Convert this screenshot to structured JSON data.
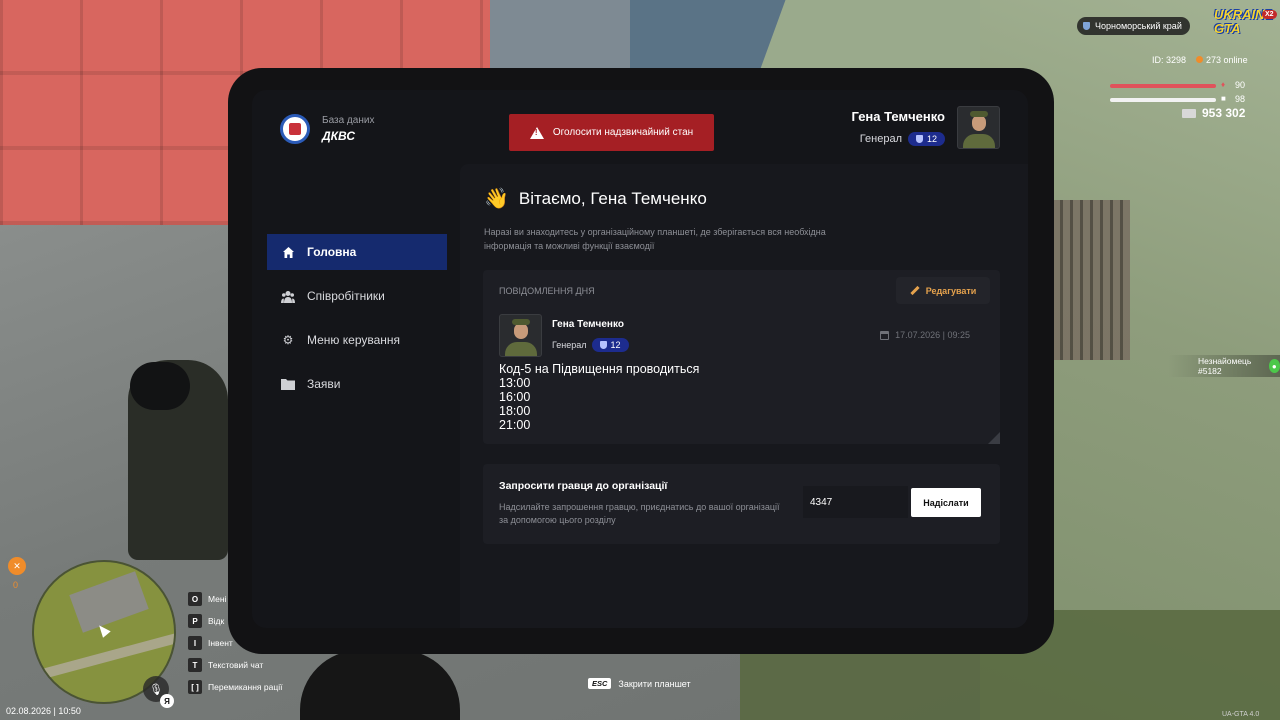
{
  "org": {
    "subtitle": "База даних",
    "name": "ДКВС"
  },
  "emergency_button": {
    "label": "Оголосити надзвичайний стан"
  },
  "profile": {
    "name": "Гена Темченко",
    "rank": "Генерал",
    "level": "12"
  },
  "sidebar": {
    "items": [
      {
        "label": "Головна",
        "icon": "home-icon",
        "active": true
      },
      {
        "label": "Співробітники",
        "icon": "people-icon",
        "active": false
      },
      {
        "label": "Меню керування",
        "icon": "gear-icon",
        "active": false
      },
      {
        "label": "Заяви",
        "icon": "folder-icon",
        "active": false
      }
    ]
  },
  "main": {
    "greeting": "Вітаємо, Гена Темченко",
    "greeting_emoji": "👋",
    "description": "Наразі ви знаходитесь у організаційному планшеті, де зберігається вся необхідна інформація та можливі функції взаємодії",
    "motd": {
      "title": "Повідомлення дня",
      "edit_label": "Редагувати",
      "author": "Гена Темченко",
      "author_rank": "Генерал",
      "author_level": "12",
      "date": "17.07.2026 | 09:25",
      "lines": [
        "Код-5 на Підвищення проводиться",
        "13:00",
        "16:00",
        "18:00",
        "21:00"
      ]
    },
    "invite": {
      "title": "Запросити гравця до організації",
      "description": "Надсилайте запрошення гравцю, приєднатись до вашої організації за допомогою цього розділу",
      "input_value": "4347",
      "send_label": "Надіслати"
    }
  },
  "hud": {
    "region": "Чорноморський край",
    "logo_line1": "UKRAINE",
    "logo_line2": "GTA",
    "logo_badge": "X2",
    "id_text": "ID: 3298",
    "online_text": "273 online",
    "health": "90",
    "armor": "98",
    "money": "953 302",
    "stranger": "Незнайомець #5182",
    "hunger_value": "0",
    "datetime": "02.08.2026 | 10:50",
    "lang": "Я",
    "key_hints": [
      {
        "key": "O",
        "label": "Мені"
      },
      {
        "key": "P",
        "label": "Відк"
      },
      {
        "key": "I",
        "label": "Інвент"
      },
      {
        "key": "T",
        "label": "Текстовий чат"
      },
      {
        "key": "[ ]",
        "label": "Перемикання рації"
      }
    ],
    "esc_key": "ESC",
    "esc_label": "Закрити планшет",
    "version": "UA-GTA 4.0"
  },
  "colors": {
    "accent_blue": "#152a6e",
    "danger_red": "#a51f24",
    "edit_orange": "#e5a24d",
    "badge_blue": "#1d2c8e"
  }
}
